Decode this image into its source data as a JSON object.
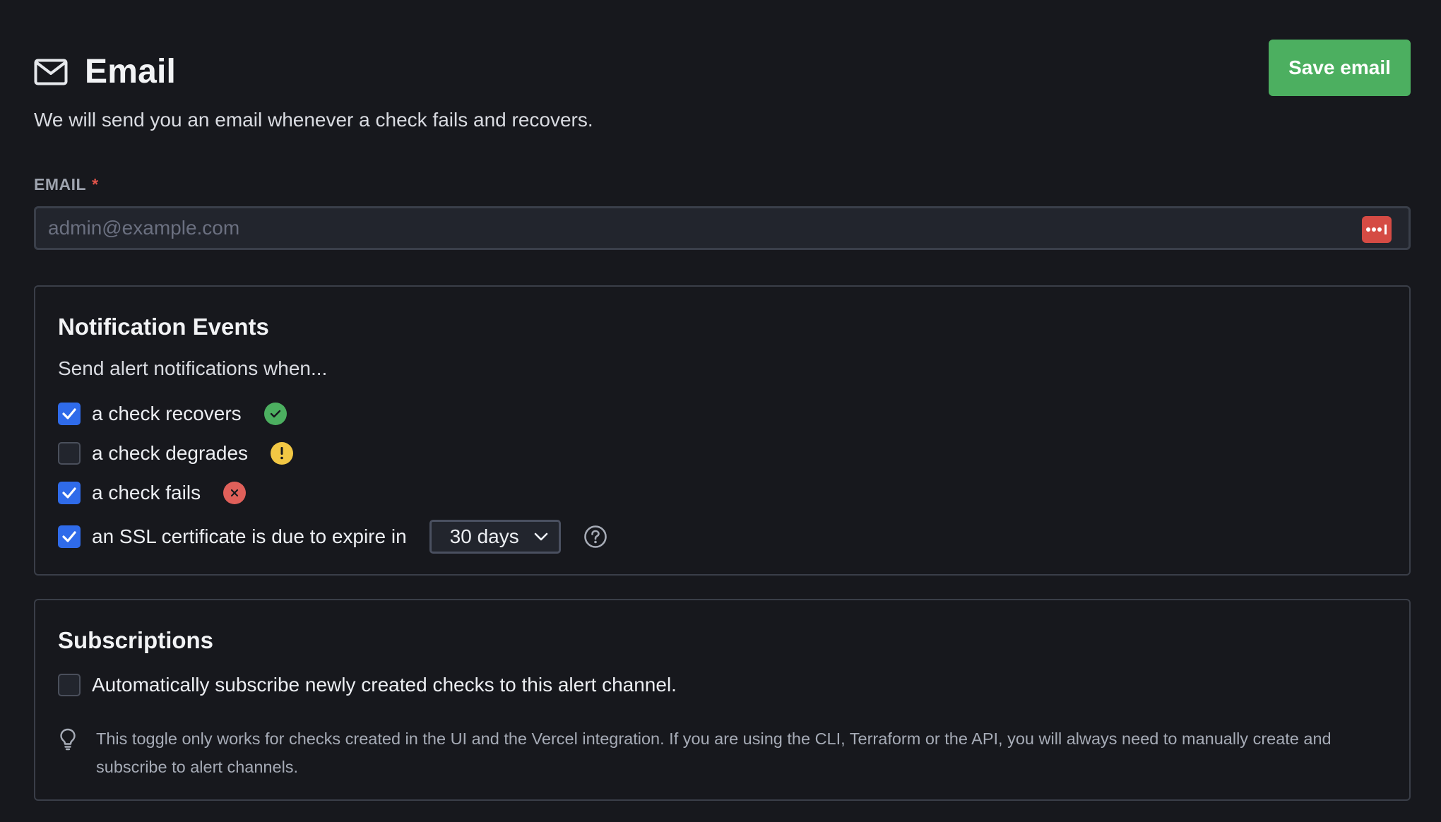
{
  "header": {
    "title": "Email",
    "save_label": "Save email",
    "subtitle": "We will send you an email whenever a check fails and recovers."
  },
  "email_field": {
    "label": "EMAIL",
    "required_mark": "*",
    "value": "",
    "placeholder": "admin@example.com"
  },
  "events": {
    "title": "Notification Events",
    "subtitle": "Send alert notifications when...",
    "items": [
      {
        "label": "a check recovers",
        "checked": true,
        "status_icon": "check-circle-icon"
      },
      {
        "label": "a check degrades",
        "checked": false,
        "status_icon": "warning-circle-icon"
      },
      {
        "label": "a check fails",
        "checked": true,
        "status_icon": "x-circle-icon"
      },
      {
        "label": "an SSL certificate is due to expire in",
        "checked": true,
        "select_value": "30 days"
      }
    ]
  },
  "subscriptions": {
    "title": "Subscriptions",
    "auto_subscribe_label": "Automatically subscribe newly created checks to this alert channel.",
    "auto_subscribe_checked": false,
    "hint": "This toggle only works for checks created in the UI and the Vercel integration. If you are using the CLI, Terraform or the API, you will always need to manually create and subscribe to alert channels."
  },
  "colors": {
    "background": "#17181d",
    "primary_button": "#4caf60",
    "checkbox_checked": "#2f6bea",
    "status_ok": "#4caf60",
    "status_warn": "#f2c744",
    "status_fail": "#e0605a"
  }
}
